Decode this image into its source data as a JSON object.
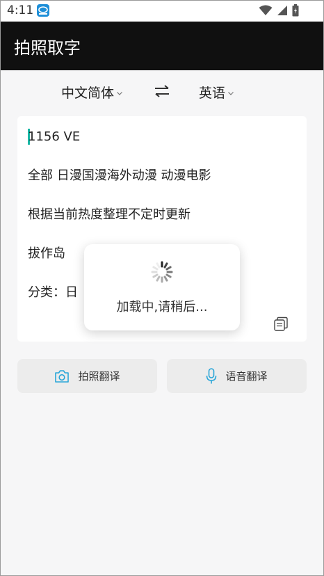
{
  "status_bar": {
    "time": "4:11"
  },
  "app_bar": {
    "title": "拍照取字"
  },
  "language": {
    "source": "中文简体",
    "target": "英语"
  },
  "text_card": {
    "lines": [
      "1156 VE",
      "全部 日漫国漫海外动漫 动漫电影",
      "根据当前热度整理不定时更新",
      "拔作岛",
      "分类：日"
    ]
  },
  "actions": {
    "photo_translate": "拍照翻译",
    "voice_translate": "语音翻译"
  },
  "loading": {
    "message": "加载中,请稍后..."
  },
  "colors": {
    "app_bar_bg": "#101010",
    "cursor": "#19b7a5",
    "accent_icon": "#2aa6d8"
  }
}
